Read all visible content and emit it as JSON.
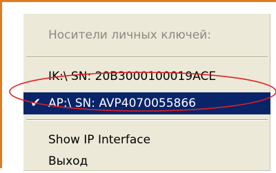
{
  "menu": {
    "header": "Носители личных ключей:",
    "items": [
      {
        "label": "IK:\\  SN: 20B3000100019ACE",
        "checked": false,
        "selected": false
      },
      {
        "label": "AP:\\  SN: AVP4070055866",
        "checked": true,
        "selected": true
      },
      {
        "label": "Show IP Interface",
        "checked": false,
        "selected": false
      },
      {
        "label": "Выход",
        "checked": false,
        "selected": false
      }
    ],
    "check_glyph": "✔"
  },
  "colors": {
    "frame_border": "#E07A1F",
    "menu_background": "#ECE9D8",
    "selection_background": "#0A246A",
    "highlight_ellipse": "#E02020",
    "disabled_text": "#8a8a80"
  },
  "icons": {
    "check": "checkmark-icon"
  }
}
